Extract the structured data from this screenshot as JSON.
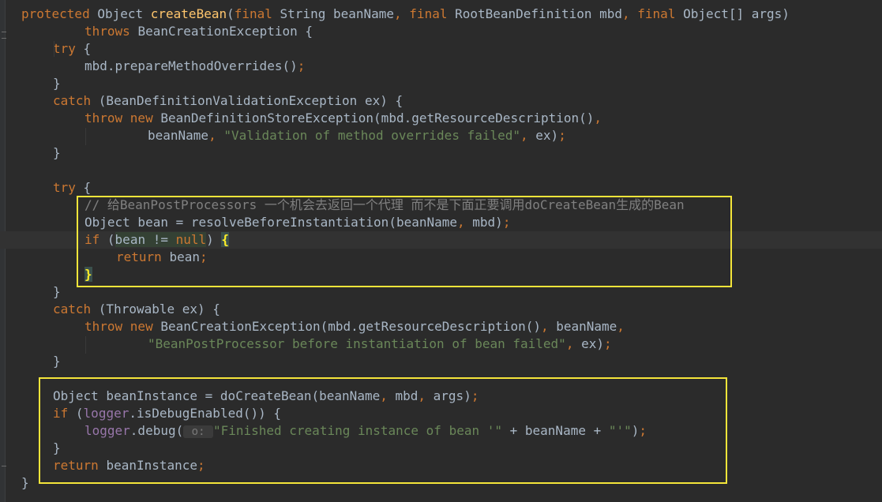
{
  "editor": {
    "lines": [
      {
        "indent": 0,
        "tokens": [
          {
            "t": "protected ",
            "c": "kw"
          },
          {
            "t": "Object ",
            "c": ""
          },
          {
            "t": "createBean",
            "c": "fn"
          },
          {
            "t": "(",
            "c": ""
          },
          {
            "t": "final ",
            "c": "kw"
          },
          {
            "t": "String beanName",
            "c": ""
          },
          {
            "t": ", ",
            "c": "kw"
          },
          {
            "t": "final ",
            "c": "kw"
          },
          {
            "t": "RootBeanDefinition mbd",
            "c": ""
          },
          {
            "t": ", ",
            "c": "kw"
          },
          {
            "t": "final ",
            "c": "kw"
          },
          {
            "t": "Object[] args)",
            "c": ""
          }
        ]
      },
      {
        "indent": 2,
        "tokens": [
          {
            "t": "throws ",
            "c": "kw"
          },
          {
            "t": "BeanCreationException {",
            "c": ""
          }
        ]
      },
      {
        "indent": 1,
        "tokens": [
          {
            "t": "try ",
            "c": "kw"
          },
          {
            "t": "{",
            "c": ""
          }
        ]
      },
      {
        "indent": 2,
        "tokens": [
          {
            "t": "mbd.prepareMethodOverrides()",
            "c": ""
          },
          {
            "t": ";",
            "c": "kw"
          }
        ]
      },
      {
        "indent": 1,
        "tokens": [
          {
            "t": "}",
            "c": ""
          }
        ]
      },
      {
        "indent": 1,
        "tokens": [
          {
            "t": "catch ",
            "c": "kw"
          },
          {
            "t": "(BeanDefinitionValidationException ex) {",
            "c": ""
          }
        ]
      },
      {
        "indent": 2,
        "tokens": [
          {
            "t": "throw ",
            "c": "kw"
          },
          {
            "t": "new ",
            "c": "kw"
          },
          {
            "t": "BeanDefinitionStoreException(mbd.getResourceDescription()",
            "c": ""
          },
          {
            "t": ",",
            "c": "kw"
          }
        ]
      },
      {
        "indent": 4,
        "tokens": [
          {
            "t": "beanName",
            "c": ""
          },
          {
            "t": ", ",
            "c": "kw"
          },
          {
            "t": "\"Validation of method overrides failed\"",
            "c": "str"
          },
          {
            "t": ", ",
            "c": "kw"
          },
          {
            "t": "ex)",
            "c": ""
          },
          {
            "t": ";",
            "c": "kw"
          }
        ]
      },
      {
        "indent": 1,
        "tokens": [
          {
            "t": "}",
            "c": ""
          }
        ]
      },
      {
        "indent": 0,
        "tokens": []
      },
      {
        "indent": 1,
        "tokens": [
          {
            "t": "try ",
            "c": "kw"
          },
          {
            "t": "{",
            "c": ""
          }
        ]
      },
      {
        "indent": 2,
        "tokens": [
          {
            "t": "// 给BeanPostProcessors 一个机会去返回一个代理 而不是下面正要调用doCreateBean生成的Bean",
            "c": "cmt"
          }
        ]
      },
      {
        "indent": 2,
        "tokens": [
          {
            "t": "Object bean = resolveBeforeInstantiation(beanName",
            "c": ""
          },
          {
            "t": ", ",
            "c": "kw"
          },
          {
            "t": "mbd)",
            "c": ""
          },
          {
            "t": ";",
            "c": "kw"
          }
        ]
      },
      {
        "indent": 2,
        "caret": true,
        "tokens": [
          {
            "t": "if ",
            "c": "kw"
          },
          {
            "t": "(",
            "c": ""
          },
          {
            "t": "bean != ",
            "c": "hl-var"
          },
          {
            "t": "null",
            "c": "kw hl-var"
          },
          {
            "t": ") ",
            "c": ""
          },
          {
            "t": "{",
            "c": "brace-match"
          }
        ]
      },
      {
        "indent": 3,
        "tokens": [
          {
            "t": "return ",
            "c": "kw"
          },
          {
            "t": "bean",
            "c": ""
          },
          {
            "t": ";",
            "c": "kw"
          }
        ]
      },
      {
        "indent": 2,
        "tokens": [
          {
            "t": "}",
            "c": "brace-match"
          }
        ]
      },
      {
        "indent": 1,
        "tokens": [
          {
            "t": "}",
            "c": ""
          }
        ]
      },
      {
        "indent": 1,
        "tokens": [
          {
            "t": "catch ",
            "c": "kw"
          },
          {
            "t": "(Throwable ex) {",
            "c": ""
          }
        ]
      },
      {
        "indent": 2,
        "tokens": [
          {
            "t": "throw ",
            "c": "kw"
          },
          {
            "t": "new ",
            "c": "kw"
          },
          {
            "t": "BeanCreationException(mbd.getResourceDescription()",
            "c": ""
          },
          {
            "t": ", ",
            "c": "kw"
          },
          {
            "t": "beanName",
            "c": ""
          },
          {
            "t": ",",
            "c": "kw"
          }
        ]
      },
      {
        "indent": 4,
        "tokens": [
          {
            "t": "\"BeanPostProcessor before instantiation of bean failed\"",
            "c": "str"
          },
          {
            "t": ", ",
            "c": "kw"
          },
          {
            "t": "ex)",
            "c": ""
          },
          {
            "t": ";",
            "c": "kw"
          }
        ]
      },
      {
        "indent": 1,
        "tokens": [
          {
            "t": "}",
            "c": ""
          }
        ]
      },
      {
        "indent": 0,
        "tokens": []
      },
      {
        "indent": 1,
        "tokens": [
          {
            "t": "Object beanInstance = doCreateBean(beanName",
            "c": ""
          },
          {
            "t": ", ",
            "c": "kw"
          },
          {
            "t": "mbd",
            "c": ""
          },
          {
            "t": ", ",
            "c": "kw"
          },
          {
            "t": "args)",
            "c": ""
          },
          {
            "t": ";",
            "c": "kw"
          }
        ]
      },
      {
        "indent": 1,
        "tokens": [
          {
            "t": "if ",
            "c": "kw"
          },
          {
            "t": "(",
            "c": ""
          },
          {
            "t": "logger",
            "c": "fld"
          },
          {
            "t": ".isDebugEnabled()) {",
            "c": ""
          }
        ]
      },
      {
        "indent": 2,
        "tokens": [
          {
            "t": "logger",
            "c": "fld"
          },
          {
            "t": ".debug(",
            "c": ""
          },
          {
            "t": " o: ",
            "c": "hint"
          },
          {
            "t": "\"Finished creating instance of bean '\"",
            "c": "str"
          },
          {
            "t": " + beanName + ",
            "c": ""
          },
          {
            "t": "\"'\"",
            "c": "str"
          },
          {
            "t": ")",
            "c": ""
          },
          {
            "t": ";",
            "c": "kw"
          }
        ]
      },
      {
        "indent": 1,
        "tokens": [
          {
            "t": "}",
            "c": ""
          }
        ]
      },
      {
        "indent": 1,
        "tokens": [
          {
            "t": "return ",
            "c": "kw"
          },
          {
            "t": "beanInstance",
            "c": ""
          },
          {
            "t": ";",
            "c": "kw"
          }
        ]
      },
      {
        "indent": 0,
        "tokens": [
          {
            "t": "}",
            "c": ""
          }
        ]
      }
    ]
  },
  "theme": {
    "background": "#2b2b2b",
    "keyword": "#cc7832",
    "method": "#ffc66d",
    "string": "#6a8759",
    "comment": "#808080",
    "field": "#9876aa",
    "highlight_box": "#f4e53a"
  }
}
